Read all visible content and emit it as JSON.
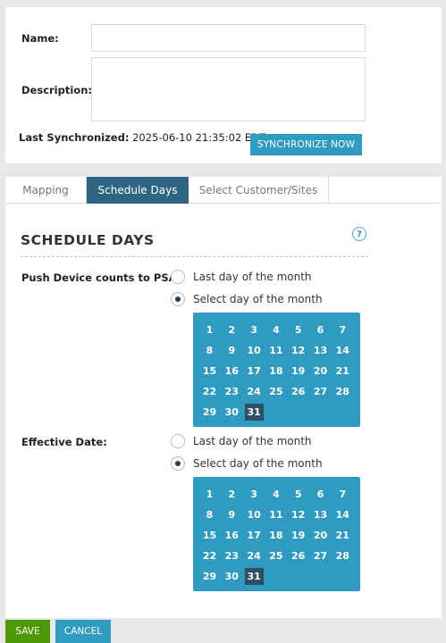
{
  "form": {
    "name_label": "Name:",
    "name_value": "",
    "description_label": "Description:",
    "description_value": "",
    "last_sync_label": "Last Synchronized:",
    "last_sync_value": "2025-06-10 21:35:02 EDT",
    "sync_button": "SYNCHRONIZE NOW"
  },
  "tabs": [
    {
      "label": "Mapping",
      "active": false
    },
    {
      "label": "Schedule Days",
      "active": true
    },
    {
      "label": "Select Customer/Sites",
      "active": false
    }
  ],
  "schedule": {
    "title": "SCHEDULE DAYS",
    "help_icon": "help-icon",
    "help_glyph": "?",
    "push": {
      "label": "Push Device counts to PSA:",
      "option_last": "Last day of the month",
      "option_select": "Select day of the month",
      "selected_option": "select",
      "selected_day": 31
    },
    "effective": {
      "label": "Effective Date:",
      "option_last": "Last day of the month",
      "option_select": "Select day of the month",
      "selected_option": "select",
      "selected_day": 31
    },
    "days": [
      1,
      2,
      3,
      4,
      5,
      6,
      7,
      8,
      9,
      10,
      11,
      12,
      13,
      14,
      15,
      16,
      17,
      18,
      19,
      20,
      21,
      22,
      23,
      24,
      25,
      26,
      27,
      28,
      29,
      30,
      31
    ]
  },
  "footer": {
    "save": "SAVE",
    "cancel": "CANCEL"
  },
  "colors": {
    "accent": "#2f9bc1",
    "tab_active": "#2e6583",
    "day_selected": "#2e4f66",
    "save": "#4e9a06"
  }
}
